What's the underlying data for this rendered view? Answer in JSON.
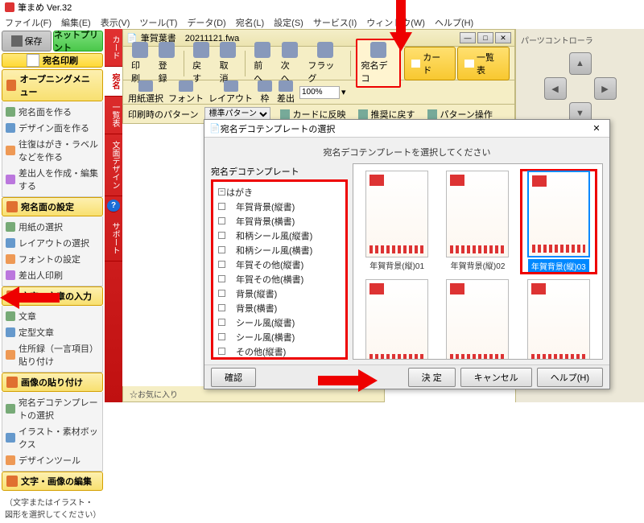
{
  "app": {
    "title": "筆まめ Ver.32"
  },
  "menu": [
    "ファイル(F)",
    "編集(E)",
    "表示(V)",
    "ツール(T)",
    "データ(D)",
    "宛名(L)",
    "設定(S)",
    "サービス(I)",
    "ウィンドウ(W)",
    "ヘルプ(H)"
  ],
  "left": {
    "save": "保存",
    "netprint": "ネットプリント",
    "atena": "宛名印刷",
    "sections": [
      {
        "title": "オープニングメニュー",
        "items": [
          "宛名面を作る",
          "デザイン面を作る",
          "往復はがき・ラベルなどを作る",
          "差出人を作成・編集する"
        ]
      },
      {
        "title": "宛名面の設定",
        "items": [
          "用紙の選択",
          "レイアウトの選択",
          "フォントの設定",
          "差出人印刷"
        ]
      },
      {
        "title": "文字・文章の入力",
        "items": [
          "文章",
          "定型文章",
          "住所録（一言項目）貼り付け"
        ]
      },
      {
        "title": "画像の貼り付け",
        "items": [
          "宛名デコテンプレートの選択",
          "イラスト・素材ボックス",
          "デザインツール"
        ]
      },
      {
        "title": "文字・画像の編集",
        "items": []
      }
    ],
    "footnote": "（文字またはイラスト・図形を選択してください）"
  },
  "redtabs": [
    "カード",
    "宛名",
    "一覧表",
    "文面デザイン",
    "?",
    "サポート"
  ],
  "doc": {
    "title": "筆賀葉書　20211121.fwa",
    "tb1": [
      "印刷",
      "登録",
      "戻す",
      "取消",
      "前へ",
      "次へ",
      "フラッグ",
      "宛名デコ"
    ],
    "tb1_right": [
      "カード",
      "一覧表"
    ],
    "tb2": [
      "用紙選択",
      "フォント",
      "レイアウト",
      "枠",
      "差出"
    ],
    "zoom": "100%",
    "tb3_label": "印刷時のパターン",
    "tb3_select": "標準パターン",
    "tb3_btns": [
      "カードに反映",
      "推奨に戻す",
      "パターン操作"
    ]
  },
  "dialog": {
    "title": "宛名デコテンプレートの選択",
    "msg": "宛名デコテンプレートを選択してください",
    "tree_label": "宛名デコテンプレート",
    "tree": [
      "はがき",
      "年賀背景(縦書)",
      "年賀背景(横書)",
      "和柄シール風(縦書)",
      "和柄シール風(横書)",
      "年賀その他(縦書)",
      "年賀その他(横書)",
      "背景(縦書)",
      "背景(横書)",
      "シール風(縦書)",
      "シール風(横書)",
      "その他(縦書)",
      "その他(横書)"
    ],
    "thumbs": [
      "年賀背景(縦)01",
      "年賀背景(縦)02",
      "年賀背景(縦)03",
      "",
      "",
      ""
    ],
    "selected_index": 2,
    "confirm": "確認",
    "ok": "決 定",
    "cancel": "キャンセル",
    "help": "ヘルプ(H)"
  },
  "right": {
    "title": "パーツコントローラ"
  },
  "favbar": "☆お気に入り"
}
